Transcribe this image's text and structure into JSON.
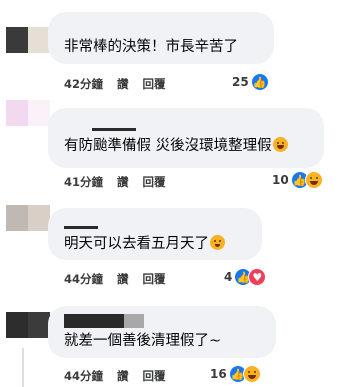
{
  "actions": {
    "like": "讚",
    "reply": "回覆"
  },
  "colors": {
    "bubble": "#f0f2f5",
    "like_blue": "#1877f2",
    "love_red": "#f33e58",
    "haha_yellow": "#f7b125"
  },
  "comments": [
    {
      "text": "非常棒的決策！市長辛苦了",
      "time": "42分鐘",
      "reaction_count": "25",
      "reactions": [
        "like-icon"
      ]
    },
    {
      "text": "有防颱準備假 災後沒環境整理假",
      "time": "41分鐘",
      "reaction_count": "10",
      "reactions": [
        "like-icon",
        "haha-icon"
      ]
    },
    {
      "text": "明天可以去看五月天了",
      "time": "44分鐘",
      "reaction_count": "4",
      "reactions": [
        "like-icon",
        "love-icon"
      ]
    },
    {
      "text": "就差一個善後清理假了~",
      "time": "44分鐘",
      "reaction_count": "16",
      "reactions": [
        "like-icon",
        "haha-icon"
      ]
    }
  ]
}
